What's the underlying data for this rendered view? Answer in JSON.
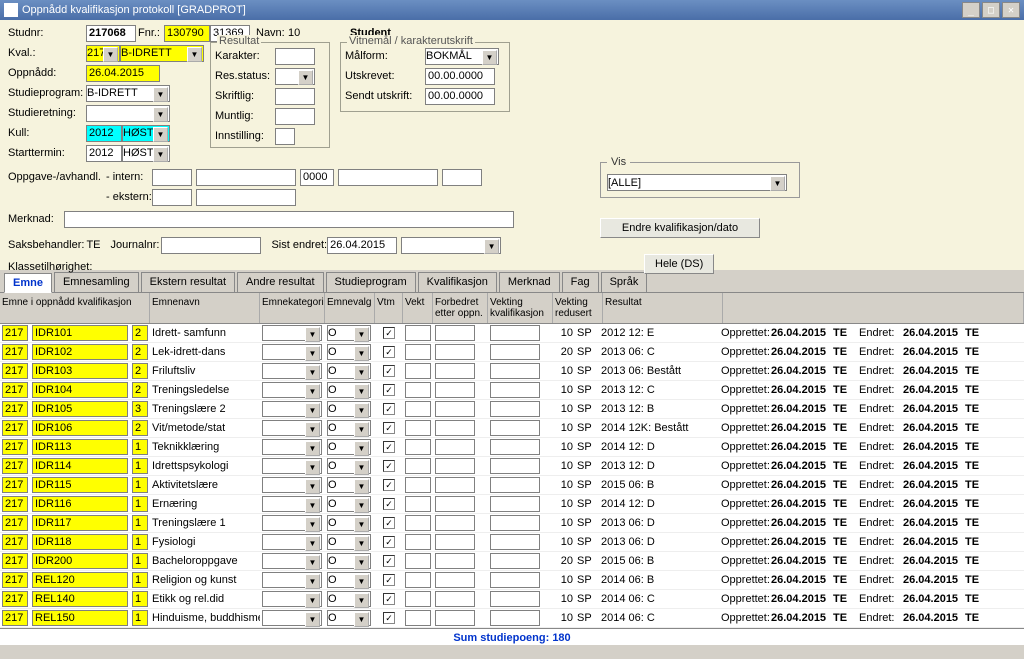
{
  "window": {
    "title": "Oppnådd kvalifikasjon protokoll  [GRADPROT]"
  },
  "header": {
    "studnr_lbl": "Studnr:",
    "studnr": "217068",
    "fnr_lbl": "Fnr.:",
    "fnr1": "130790",
    "fnr2": "31369",
    "navn_lbl": "Navn:",
    "navn": "10",
    "student_lbl": "Student",
    "kval_lbl": "Kval.:",
    "kval_code": "217",
    "kval_name": "B-IDRETT",
    "oppnaadd_lbl": "Oppnådd:",
    "oppnaadd": "26.04.2015",
    "studieprogram_lbl": "Studieprogram:",
    "studieprogram": "B-IDRETT",
    "studieretning_lbl": "Studieretning:",
    "kull_lbl": "Kull:",
    "kull_year": "2012",
    "kull_sem": "HØST",
    "starttermin_lbl": "Starttermin:",
    "start_year": "2012",
    "start_sem": "HØST",
    "resultat_grp": "Resultat",
    "karakter_lbl": "Karakter:",
    "resstatus_lbl": "Res.status:",
    "skriftlig_lbl": "Skriftlig:",
    "muntlig_lbl": "Muntlig:",
    "innstilling_lbl": "Innstilling:",
    "vitnemal_grp": "Vitnemål / karakterutskrift",
    "maalform_lbl": "Målform:",
    "maalform": "BOKMÅL",
    "utskrevet_lbl": "Utskrevet:",
    "utskrevet": "00.00.0000",
    "sendtutskrift_lbl": "Sendt utskrift:",
    "sendtutskrift": "00.00.0000",
    "oppgave_lbl": "Oppgave-/avhandl.",
    "intern_lbl": "- intern:",
    "intern_code": "0000",
    "ekstern_lbl": "- ekstern:",
    "merknad_lbl": "Merknad:",
    "saksbehandler_lbl": "Saksbehandler:",
    "saksbehandler": "TE",
    "journalnr_lbl": "Journalnr:",
    "sistendret_lbl": "Sist endret:",
    "sistendret": "26.04.2015",
    "klasse_lbl": "Klassetilhørighet:",
    "vis_grp": "Vis",
    "vis_val": "[ALLE]",
    "endre_btn": "Endre kvalifikasjon/dato",
    "hele_btn": "Hele (DS)"
  },
  "tabs": [
    "Emne",
    "Emnesamling",
    "Ekstern resultat",
    "Andre resultat",
    "Studieprogram",
    "Kvalifikasjon",
    "Merknad",
    "Fag",
    "Språk"
  ],
  "grid": {
    "headers": {
      "c0": "Emne i oppnådd kvalifikasjon",
      "c1": "Emnenavn",
      "c2": "Emnekategori",
      "c3": "Emnevalg",
      "c4": "Vtm",
      "c5": "Vekt",
      "c6": "Forbedret etter oppn.",
      "c7": "Vekting kvalifikasjon",
      "c8": "Vekting redusert",
      "c9": "Resultat",
      "opprettet": "Opprettet:",
      "endret": "Endret:"
    },
    "rows": [
      {
        "a": "217",
        "b": "IDR101",
        "c": "2",
        "navn": "Idrett- samfunn",
        "valg": "O",
        "chk": true,
        "vk": "10",
        "sp": "SP",
        "res": "2012 12: E",
        "opp": "26.04.2015",
        "te1": "TE",
        "end": "26.04.2015",
        "te2": "TE"
      },
      {
        "a": "217",
        "b": "IDR102",
        "c": "2",
        "navn": "Lek-idrett-dans",
        "valg": "O",
        "chk": true,
        "vk": "20",
        "sp": "SP",
        "res": "2013 06: C",
        "opp": "26.04.2015",
        "te1": "TE",
        "end": "26.04.2015",
        "te2": "TE"
      },
      {
        "a": "217",
        "b": "IDR103",
        "c": "2",
        "navn": "Friluftsliv",
        "valg": "O",
        "chk": true,
        "vk": "10",
        "sp": "SP",
        "res": "2013 06: Bestått",
        "opp": "26.04.2015",
        "te1": "TE",
        "end": "26.04.2015",
        "te2": "TE"
      },
      {
        "a": "217",
        "b": "IDR104",
        "c": "2",
        "navn": "Treningsledelse",
        "valg": "O",
        "chk": true,
        "vk": "10",
        "sp": "SP",
        "res": "2013 12: C",
        "opp": "26.04.2015",
        "te1": "TE",
        "end": "26.04.2015",
        "te2": "TE"
      },
      {
        "a": "217",
        "b": "IDR105",
        "c": "3",
        "navn": "Treningslære 2",
        "valg": "O",
        "chk": true,
        "vk": "10",
        "sp": "SP",
        "res": "2013 12: B",
        "opp": "26.04.2015",
        "te1": "TE",
        "end": "26.04.2015",
        "te2": "TE"
      },
      {
        "a": "217",
        "b": "IDR106",
        "c": "2",
        "navn": "Vit/metode/stat",
        "valg": "O",
        "chk": true,
        "vk": "10",
        "sp": "SP",
        "res": "2014 12K: Bestått",
        "opp": "26.04.2015",
        "te1": "TE",
        "end": "26.04.2015",
        "te2": "TE"
      },
      {
        "a": "217",
        "b": "IDR113",
        "c": "1",
        "navn": "Teknikklæring",
        "valg": "O",
        "chk": true,
        "vk": "10",
        "sp": "SP",
        "res": "2014 12: D",
        "opp": "26.04.2015",
        "te1": "TE",
        "end": "26.04.2015",
        "te2": "TE"
      },
      {
        "a": "217",
        "b": "IDR114",
        "c": "1",
        "navn": "Idrettspsykologi",
        "valg": "O",
        "chk": true,
        "vk": "10",
        "sp": "SP",
        "res": "2013 12: D",
        "opp": "26.04.2015",
        "te1": "TE",
        "end": "26.04.2015",
        "te2": "TE"
      },
      {
        "a": "217",
        "b": "IDR115",
        "c": "1",
        "navn": "Aktivitetslære",
        "valg": "O",
        "chk": true,
        "vk": "10",
        "sp": "SP",
        "res": "2015 06: B",
        "opp": "26.04.2015",
        "te1": "TE",
        "end": "26.04.2015",
        "te2": "TE"
      },
      {
        "a": "217",
        "b": "IDR116",
        "c": "1",
        "navn": "Ernæring",
        "valg": "O",
        "chk": true,
        "vk": "10",
        "sp": "SP",
        "res": "2014 12: D",
        "opp": "26.04.2015",
        "te1": "TE",
        "end": "26.04.2015",
        "te2": "TE"
      },
      {
        "a": "217",
        "b": "IDR117",
        "c": "1",
        "navn": "Treningslære 1",
        "valg": "O",
        "chk": true,
        "vk": "10",
        "sp": "SP",
        "res": "2013 06: D",
        "opp": "26.04.2015",
        "te1": "TE",
        "end": "26.04.2015",
        "te2": "TE"
      },
      {
        "a": "217",
        "b": "IDR118",
        "c": "1",
        "navn": "Fysiologi",
        "valg": "O",
        "chk": true,
        "vk": "10",
        "sp": "SP",
        "res": "2013 06: D",
        "opp": "26.04.2015",
        "te1": "TE",
        "end": "26.04.2015",
        "te2": "TE"
      },
      {
        "a": "217",
        "b": "IDR200",
        "c": "1",
        "navn": "Bacheloroppgave",
        "valg": "O",
        "chk": true,
        "vk": "20",
        "sp": "SP",
        "res": "2015 06: B",
        "opp": "26.04.2015",
        "te1": "TE",
        "end": "26.04.2015",
        "te2": "TE"
      },
      {
        "a": "217",
        "b": "REL120",
        "c": "1",
        "navn": "Religion og kunst",
        "valg": "O",
        "chk": true,
        "vk": "10",
        "sp": "SP",
        "res": "2014 06: B",
        "opp": "26.04.2015",
        "te1": "TE",
        "end": "26.04.2015",
        "te2": "TE"
      },
      {
        "a": "217",
        "b": "REL140",
        "c": "1",
        "navn": "Etikk og rel.did",
        "valg": "O",
        "chk": true,
        "vk": "10",
        "sp": "SP",
        "res": "2014 06: C",
        "opp": "26.04.2015",
        "te1": "TE",
        "end": "26.04.2015",
        "te2": "TE"
      },
      {
        "a": "217",
        "b": "REL150",
        "c": "1",
        "navn": "Hinduisme, buddhisme",
        "valg": "O",
        "chk": true,
        "vk": "10",
        "sp": "SP",
        "res": "2014 06: C",
        "opp": "26.04.2015",
        "te1": "TE",
        "end": "26.04.2015",
        "te2": "TE"
      }
    ],
    "sum": "Sum studiepoeng: 180"
  }
}
